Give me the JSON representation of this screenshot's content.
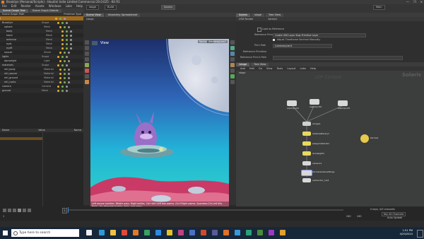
{
  "window": {
    "title": "Brooklyn (Personal/Scripts) - Houdini Indie Limited Commercial 20.0.625 - Kit R1",
    "controls": [
      "—",
      "❐",
      "✕"
    ]
  },
  "menubar": [
    "File",
    "Edit",
    "Render",
    "Assets",
    "Windows",
    "Labs",
    "Help"
  ],
  "shelf": {
    "desktop_button": "Solaris",
    "stage": "stage",
    "build": "Build",
    "main": "Main"
  },
  "left_panel": {
    "tabs": [
      "Scene Graph Tree",
      "Scene Graph Details"
    ],
    "header": {
      "name": "Scene Graph Path",
      "kind": "Primitive Type"
    },
    "rows": [
      {
        "name": "/",
        "kind": ""
      },
      {
        "name": "Brooklyn",
        "kind": "Scope"
      },
      {
        "name": "sphere",
        "kind": "Mesh"
      },
      {
        "name": "body",
        "kind": "Mesh"
      },
      {
        "name": "hand",
        "kind": "Mesh"
      },
      {
        "name": "antenna",
        "kind": "Mesh"
      },
      {
        "name": "eyeL",
        "kind": "Mesh"
      },
      {
        "name": "eyeR",
        "kind": "Mesh"
      },
      {
        "name": "saucer",
        "kind": "Xform"
      },
      {
        "name": "lights",
        "kind": "Scope"
      },
      {
        "name": "domelight",
        "kind": "Light"
      },
      {
        "name": "materials",
        "kind": "Scope"
      },
      {
        "name": "mtl_body",
        "kind": "Material"
      },
      {
        "name": "mtl_saucer",
        "kind": "Material"
      },
      {
        "name": "mtl_ground",
        "kind": "Material"
      },
      {
        "name": "mtl_rocks",
        "kind": "Material"
      },
      {
        "name": "camera",
        "kind": "Camera"
      },
      {
        "name": "ground",
        "kind": "Mesh"
      }
    ],
    "bottom": {
      "name": "Name",
      "value": "Value",
      "pane2": "Name"
    }
  },
  "viewport": {
    "tabs": [
      "Scene View",
      "Geometry Spreadsheet"
    ],
    "path_label": "/stage",
    "view_label": "View",
    "camera_label": "Karma XPU",
    "camera_button": "/cameras/cam1",
    "status_line": "Left mouse tumbles. Middle pans. Right dollies. Ctrl+Alt+Left box-zooms. Ctrl+Right zooms. Spacebar-Ctrl-Left tilts. Hold L for alternate tumble, dolly, and zoom."
  },
  "properties": {
    "tabs": [
      "Solaris",
      "stage",
      "Tree View"
    ],
    "node_title": "USD Render",
    "node_name": "karma1",
    "rows": [
      {
        "label": "",
        "value": "Load as Reference"
      },
      {
        "label": "Reference Prim",
        "value": "Create USD Layer Stop Primitive Layer"
      },
      {
        "label": "",
        "value": "Adjust Timeframe Sentinel Manually"
      },
      {
        "label": "Prim Path",
        "value": "/cameras/cam1"
      },
      {
        "label": "Reference Primitive",
        "value": ""
      },
      {
        "label": "Reference Prim's Path",
        "value": ""
      }
    ]
  },
  "network": {
    "tabs": [
      "/stage",
      "Tree View"
    ],
    "menu": [
      "Add",
      "Edit",
      "Go",
      "View",
      "Tools",
      "Layout",
      "Labs",
      "Help"
    ],
    "path": "stage",
    "context_label": "Solaris",
    "watermark": "LOP Context",
    "nodes": [
      {
        "name": "sopimport1",
        "color": "#d8d8d8"
      },
      {
        "name": "sopimport2",
        "color": "#d8d8d8"
      },
      {
        "name": "sopimport3",
        "color": "#d8d8d8"
      },
      {
        "name": "merge1",
        "color": "#d0d0d0"
      },
      {
        "name": "materiallibrary1",
        "color": "#e8d860"
      },
      {
        "name": "assignmaterial1",
        "color": "#e8d860"
      },
      {
        "name": "domelight1",
        "color": "#e8d860"
      },
      {
        "name": "camera1",
        "color": "#d8d8d8"
      },
      {
        "name": "karmarendersettings",
        "color": "#d8d8d8"
      },
      {
        "name": "usdrender_rop1",
        "color": "#d8d8d8"
      },
      {
        "name": "karma1",
        "color": "#e8c84a"
      }
    ]
  },
  "timeline": {
    "frame": "1",
    "start": "1",
    "end": "240",
    "end2": "240",
    "keys_label": "0 keys, 0/0 channels",
    "key_all": "Key All Channels",
    "auto_update": "Auto Update"
  },
  "taskbar": {
    "search_placeholder": "Type here to search",
    "time": "1:51 PM",
    "date": "4/29/2024"
  }
}
